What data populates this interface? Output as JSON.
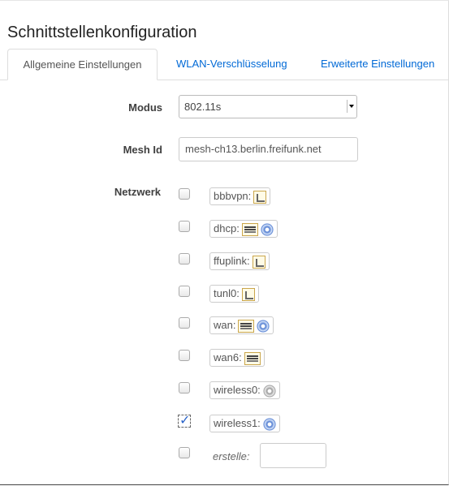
{
  "section": {
    "title": "Schnittstellenkonfiguration"
  },
  "tabs": [
    {
      "label": "Allgemeine Einstellungen",
      "active": true
    },
    {
      "label": "WLAN-Verschlüsselung",
      "active": false
    },
    {
      "label": "Erweiterte Einstellungen",
      "active": false
    }
  ],
  "form": {
    "mode_label": "Modus",
    "mode_value": "802.11s",
    "meshid_label": "Mesh Id",
    "meshid_value": "mesh-ch13.berlin.freifunk.net",
    "network_label": "Netzwerk"
  },
  "networks": [
    {
      "label": "bbbvpn:",
      "checked": false,
      "icons": [
        "ethernet-port-icon"
      ]
    },
    {
      "label": "dhcp:",
      "checked": false,
      "icons": [
        "bridge-icon",
        "wifi-icon"
      ]
    },
    {
      "label": "ffuplink:",
      "checked": false,
      "icons": [
        "ethernet-port-icon"
      ]
    },
    {
      "label": "tunl0:",
      "checked": false,
      "icons": [
        "ethernet-port-icon"
      ]
    },
    {
      "label": "wan:",
      "checked": false,
      "icons": [
        "bridge-icon",
        "wifi-icon"
      ]
    },
    {
      "label": "wan6:",
      "checked": false,
      "icons": [
        "bridge-icon"
      ]
    },
    {
      "label": "wireless0:",
      "checked": false,
      "icons": [
        "wifi-disabled-icon"
      ]
    },
    {
      "label": "wireless1:",
      "checked": true,
      "icons": [
        "wifi-icon"
      ]
    }
  ],
  "create": {
    "label": "erstelle:",
    "value": ""
  }
}
